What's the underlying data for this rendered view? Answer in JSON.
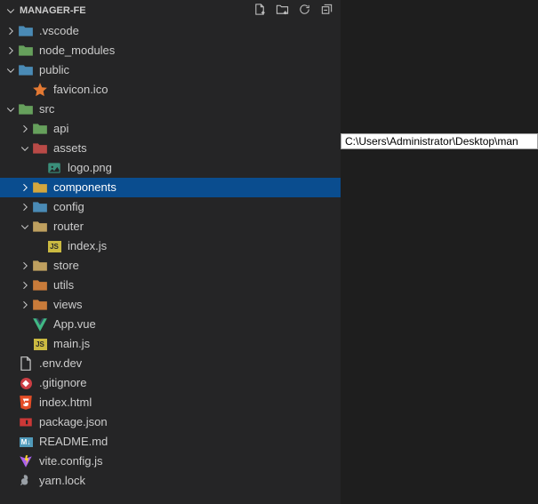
{
  "header": {
    "title": "MANAGER-FE"
  },
  "tooltip": {
    "text": "C:\\Users\\Administrator\\Desktop\\man"
  },
  "icons": {
    "js": "JS",
    "md": "M↓"
  },
  "tree": [
    {
      "depth": 0,
      "chev": "right",
      "icon": "folder-blue",
      "label": ".vscode"
    },
    {
      "depth": 0,
      "chev": "right",
      "icon": "folder-teal",
      "label": "node_modules"
    },
    {
      "depth": 0,
      "chev": "down",
      "icon": "folder-blue",
      "label": "public"
    },
    {
      "depth": 1,
      "chev": "",
      "icon": "star",
      "label": "favicon.ico"
    },
    {
      "depth": 0,
      "chev": "down",
      "icon": "folder-teal",
      "label": "src"
    },
    {
      "depth": 1,
      "chev": "right",
      "icon": "folder-teal",
      "label": "api"
    },
    {
      "depth": 1,
      "chev": "down",
      "icon": "folder-red",
      "label": "assets"
    },
    {
      "depth": 2,
      "chev": "",
      "icon": "image",
      "label": "logo.png"
    },
    {
      "depth": 1,
      "chev": "right",
      "icon": "folder-yellow",
      "label": "components",
      "selected": true
    },
    {
      "depth": 1,
      "chev": "right",
      "icon": "folder-blue",
      "label": "config"
    },
    {
      "depth": 1,
      "chev": "down",
      "icon": "folder-generic",
      "label": "router"
    },
    {
      "depth": 2,
      "chev": "",
      "icon": "js",
      "label": "index.js"
    },
    {
      "depth": 1,
      "chev": "right",
      "icon": "folder-generic",
      "label": "store"
    },
    {
      "depth": 1,
      "chev": "right",
      "icon": "folder-orange",
      "label": "utils"
    },
    {
      "depth": 1,
      "chev": "right",
      "icon": "folder-orange",
      "label": "views"
    },
    {
      "depth": 1,
      "chev": "",
      "icon": "vue",
      "label": "App.vue"
    },
    {
      "depth": 1,
      "chev": "",
      "icon": "js",
      "label": "main.js"
    },
    {
      "depth": 0,
      "chev": "",
      "icon": "file",
      "label": ".env.dev"
    },
    {
      "depth": 0,
      "chev": "",
      "icon": "git",
      "label": ".gitignore"
    },
    {
      "depth": 0,
      "chev": "",
      "icon": "html",
      "label": "index.html"
    },
    {
      "depth": 0,
      "chev": "",
      "icon": "npm",
      "label": "package.json"
    },
    {
      "depth": 0,
      "chev": "",
      "icon": "md",
      "label": "README.md"
    },
    {
      "depth": 0,
      "chev": "",
      "icon": "vite",
      "label": "vite.config.js"
    },
    {
      "depth": 0,
      "chev": "",
      "icon": "yarn",
      "label": "yarn.lock"
    }
  ]
}
